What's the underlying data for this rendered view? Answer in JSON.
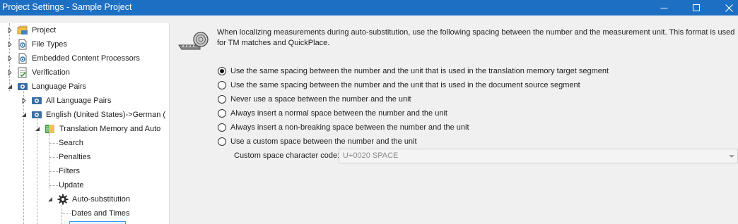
{
  "window": {
    "title": "Project Settings - Sample Project",
    "controls": [
      "minimize-icon",
      "maximize-icon",
      "close-icon"
    ]
  },
  "tree": {
    "items": [
      {
        "label": "Project",
        "icon": "project-icon"
      },
      {
        "label": "File Types",
        "icon": "file-types-icon"
      },
      {
        "label": "Embedded Content Processors",
        "icon": "embedded-content-icon"
      },
      {
        "label": "Verification",
        "icon": "verification-icon"
      },
      {
        "label": "Language Pairs",
        "icon": "language-pairs-icon"
      },
      {
        "label": "All Language Pairs",
        "icon": "language-pairs-icon"
      },
      {
        "label": "English (United States)->German (",
        "icon": "language-pairs-icon"
      },
      {
        "label": "Translation Memory and Auto",
        "icon": "translation-memory-icon"
      },
      {
        "label": "Search"
      },
      {
        "label": "Penalties"
      },
      {
        "label": "Filters"
      },
      {
        "label": "Update"
      },
      {
        "label": "Auto-substitution",
        "icon": "gear-icon"
      },
      {
        "label": "Dates and Times"
      }
    ]
  },
  "content": {
    "icon": "measurement-tape-icon",
    "description": "When localizing measurements during auto-substitution, use the following spacing between the number and the measurement unit. This format is used for TM matches and QuickPlace.",
    "options": [
      {
        "label": "Use the same spacing between the number and the unit that is used in the translation memory target segment",
        "checked": true
      },
      {
        "label": "Use the same spacing between the number and the unit that is used in the document source segment",
        "checked": false
      },
      {
        "label": "Never use a space between the number and the unit",
        "checked": false
      },
      {
        "label": "Always insert a normal space between the number and the unit",
        "checked": false
      },
      {
        "label": "Always insert a non-breaking space between the number and the unit",
        "checked": false
      },
      {
        "label": "Use a custom space between the number and the unit",
        "checked": false
      }
    ],
    "custom_label": "Custom space character code:",
    "custom_value": "U+0020 SPACE"
  },
  "colors": {
    "titlebar": "#1c6fc3",
    "tree_background": "#ffffff",
    "panel_background": "#f0f0f0"
  }
}
